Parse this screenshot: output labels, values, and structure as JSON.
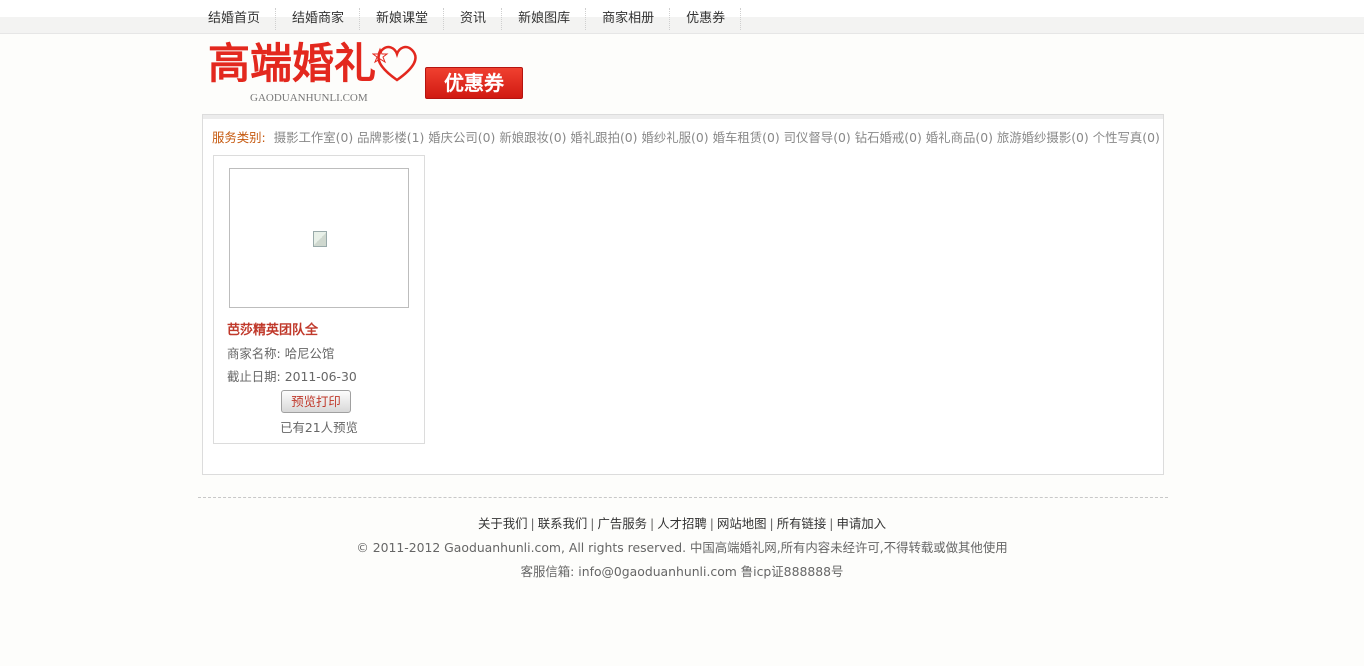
{
  "nav": {
    "items": [
      {
        "label": "结婚首页"
      },
      {
        "label": "结婚商家"
      },
      {
        "label": "新娘课堂"
      },
      {
        "label": "资讯"
      },
      {
        "label": "新娘图库"
      },
      {
        "label": "商家相册"
      },
      {
        "label": "优惠券"
      }
    ]
  },
  "logo": {
    "title": "高端婚礼",
    "subtitle": "GAODUANHUNLI.COM",
    "badge": "优惠券",
    "accent_color": "#e3281e"
  },
  "categories": {
    "label": "服务类别:",
    "items": [
      "摄影工作室(0)",
      "品牌影楼(1)",
      "婚庆公司(0)",
      "新娘跟妆(0)",
      "婚礼跟拍(0)",
      "婚纱礼服(0)",
      "婚车租赁(0)",
      "司仪督导(0)",
      "钻石婚戒(0)",
      "婚礼商品(0)",
      "旅游婚纱摄影(0)",
      "个性写真(0)"
    ]
  },
  "coupon": {
    "title": "芭莎精英团队全",
    "merchant_label": "商家名称:",
    "merchant": "哈尼公馆",
    "deadline_label": "截止日期:",
    "deadline": "2011-06-30",
    "print_button": "预览打印",
    "views": "已有21人预览"
  },
  "footer": {
    "links": [
      "关于我们",
      "联系我们",
      "广告服务",
      "人才招聘",
      "网站地图",
      "所有链接",
      "申请加入"
    ],
    "copyright": "© 2011-2012 Gaoduanhunli.com, All rights reserved. 中国高端婚礼网,所有内容未经许可,不得转载或做其他使用",
    "contact": "客服信箱: info@0gaoduanhunli.com 鲁icp证888888号"
  }
}
